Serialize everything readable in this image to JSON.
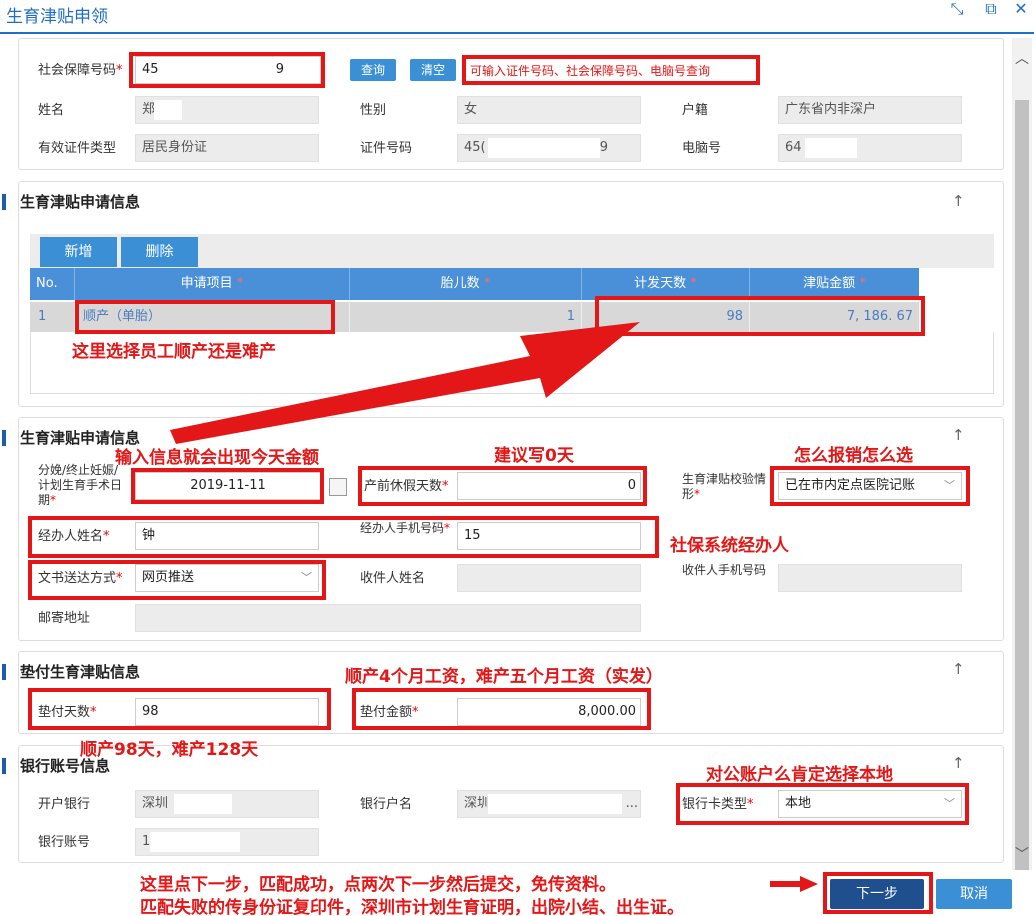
{
  "window": {
    "title": "生育津贴申领"
  },
  "icons": {
    "resize": "resize-icon",
    "popout": "popout-icon",
    "close": "close-icon",
    "calendar": "calendar-icon",
    "scroll_up": "chevron-up-icon",
    "scroll_down": "chevron-down-icon",
    "collapse": "arrow-up-icon"
  },
  "person": {
    "ss_label": "社会保障号码",
    "ss_value": "45",
    "ss_tail": "9",
    "query_label": "查询",
    "clear_label": "清空",
    "hint": "可输入证件号码、社会保障号码、电脑号查询",
    "name_label": "姓名",
    "name_value": "郑",
    "gender_label": "性别",
    "gender_value": "女",
    "huji_label": "户籍",
    "huji_value": "广东省内非深户",
    "idtype_label": "有效证件类型",
    "idtype_value": "居民身份证",
    "idno_label": "证件号码",
    "idno_value": "45(",
    "idno_tail": "9",
    "pcno_label": "电脑号",
    "pcno_value": "64"
  },
  "apply_section": {
    "title": "生育津贴申请信息",
    "add_label": "新增",
    "delete_label": "删除",
    "columns": [
      "No.",
      "申请项目",
      "胎儿数",
      "计发天数",
      "津贴金额"
    ],
    "rows": [
      {
        "no": "1",
        "item": "顺产（单胎）",
        "fetus": "1",
        "days": "98",
        "amount": "7, 186. 67"
      }
    ]
  },
  "apply_info": {
    "title": "生育津贴申请信息",
    "date_label": "分娩/终止妊娠/计划生育手术日期",
    "date_value": "2019-11-11",
    "prenatal_label": "产前休假天数",
    "prenatal_value": "0",
    "verify_label": "生育津贴校验情形",
    "verify_value": "已在市内定点医院记账",
    "handler_label": "经办人姓名",
    "handler_value": "钟",
    "handler_phone_label": "经办人手机号码",
    "handler_phone_value": "15",
    "delivery_label": "文书送达方式",
    "delivery_value": "网页推送",
    "receiver_label": "收件人姓名",
    "receiver_phone_label": "收件人手机号码",
    "mail_label": "邮寄地址"
  },
  "advance": {
    "title": "垫付生育津贴信息",
    "days_label": "垫付天数",
    "days_value": "98",
    "amount_label": "垫付金额",
    "amount_value": "8,000.00"
  },
  "bank": {
    "title": "银行账号信息",
    "bank_label": "开户银行",
    "bank_value": "深圳",
    "holder_label": "银行户名",
    "holder_value": "深圳",
    "holder_tail": "...",
    "cardtype_label": "银行卡类型",
    "cardtype_value": "本地",
    "account_label": "银行账号",
    "account_value": "1"
  },
  "footer": {
    "next_label": "下一步",
    "cancel_label": "取消"
  },
  "annotations": {
    "n1": "这里选择员工顺产还是难产",
    "n2": "输入信息就会出现今天金额",
    "n3": "建议写0天",
    "n4": "怎么报销怎么选",
    "n5": "社保系统经办人",
    "n6": "顺产4个月工资，难产五个月工资（实发）",
    "n7": "顺产98天，难产128天",
    "n8": "对公账户么肯定选择本地",
    "n9": "这里点下一步，匹配成功，点两次下一步然后提交，免传资料。",
    "n10": "匹配失败的传身份证复印件，深圳市计划生育证明，出院小结、出生证。"
  },
  "colors": {
    "accent": "#3b8fd5",
    "annotation": "#e31717",
    "grid_header": "#4a90d9",
    "next_button": "#1f4f8f"
  }
}
